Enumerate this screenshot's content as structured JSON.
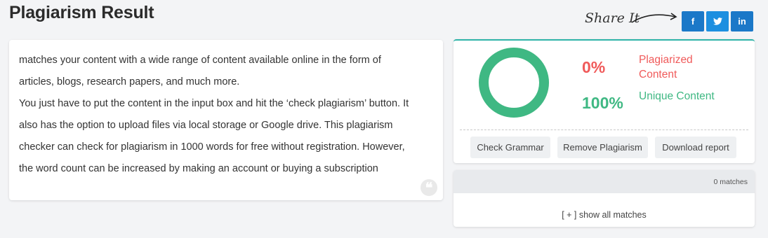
{
  "header": {
    "title": "Plagiarism Result",
    "share_label": "Share It",
    "social": {
      "facebook": "f",
      "twitter": "t",
      "linkedin": "in"
    }
  },
  "content": {
    "lines": [
      "matches your content with a wide range of content available online in the form of",
      "articles, blogs, research papers, and much more.",
      "You just have to put the content in the input box and hit the ‘check plagiarism’ button. It",
      "also has the option to upload files via local storage or Google drive. This plagiarism",
      "checker can check for plagiarism in 1000 words for free without registration. However,",
      "the word count can be increased by making an account or buying a subscription"
    ]
  },
  "result": {
    "plagiarized_percent": "0%",
    "plagiarized_label": "Plagiarized Content",
    "unique_percent": "100%",
    "unique_label": "Unique Content",
    "unique_fraction": 1.0,
    "colors": {
      "plagiarized": "#f05a5a",
      "unique": "#3fb883"
    },
    "actions": {
      "check_grammar": "Check Grammar",
      "remove_plagiarism": "Remove Plagiarism",
      "download_report": "Download report"
    }
  },
  "matches": {
    "count_text": "0 matches",
    "show_all": "[ + ] show all matches"
  }
}
